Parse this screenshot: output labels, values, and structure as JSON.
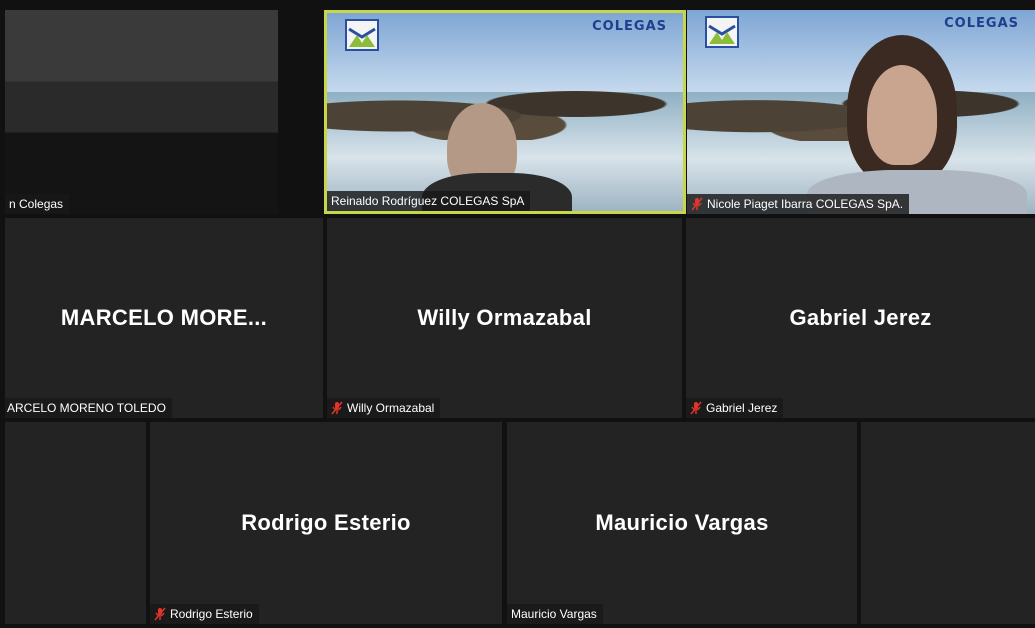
{
  "tiles": [
    {
      "id": "room",
      "label": "n Colegas",
      "muted": false,
      "type": "video"
    },
    {
      "id": "reinaldo",
      "label": "Reinaldo Rodríguez  COLEGAS SpA",
      "muted": false,
      "type": "video",
      "active": true,
      "brand": "COLEGAS"
    },
    {
      "id": "nicole",
      "label": "Nicole Piaget Ibarra COLEGAS SpA.",
      "muted": true,
      "type": "video",
      "brand": "COLEGAS"
    },
    {
      "id": "marcelo",
      "display_name": "MARCELO  MORE...",
      "label": "ARCELO MORENO TOLEDO",
      "muted": false
    },
    {
      "id": "willy",
      "display_name": "Willy Ormazabal",
      "label": "Willy Ormazabal",
      "muted": true
    },
    {
      "id": "gabriel",
      "display_name": "Gabriel Jerez",
      "label": "Gabriel Jerez",
      "muted": true
    },
    {
      "id": "rodrigo",
      "display_name": "Rodrigo Esterio",
      "label": "Rodrigo Esterio",
      "muted": true
    },
    {
      "id": "mauricio",
      "display_name": "Mauricio Vargas",
      "label": "Mauricio Vargas",
      "muted": false
    }
  ],
  "colors": {
    "active_border": "#c8d64a",
    "mic_muted": "#e0352b",
    "tile_bg": "#232323"
  }
}
